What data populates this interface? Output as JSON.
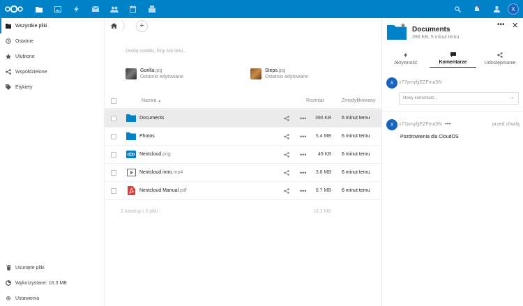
{
  "colors": {
    "brand": "#0082c9",
    "avatar": "#1565c0",
    "selected_row": "#ebebeb"
  },
  "header": {
    "avatar_initial": "X",
    "apps": [
      {
        "icon": "files-icon"
      },
      {
        "icon": "photos-icon"
      },
      {
        "icon": "activity-icon"
      },
      {
        "icon": "mail-icon"
      },
      {
        "icon": "contacts-icon"
      },
      {
        "icon": "calendar-icon"
      },
      {
        "icon": "deck-icon"
      }
    ],
    "right_icons": [
      "search-icon",
      "notifications-icon",
      "contacts-menu-icon"
    ]
  },
  "sidebar": {
    "items": [
      {
        "label": "Wszystkie pliki",
        "icon": "folder-icon"
      },
      {
        "label": "Ostatnie",
        "icon": "clock-icon"
      },
      {
        "label": "Ulubione",
        "icon": "star-icon"
      },
      {
        "label": "Współdzielone",
        "icon": "share-icon"
      },
      {
        "label": "Etykiety",
        "icon": "tag-icon"
      }
    ],
    "bottom": [
      {
        "label": "Usunięte pliki",
        "icon": "trash-icon"
      },
      {
        "label": "Wykorzystane: 16.3 MB",
        "icon": "quota-icon"
      },
      {
        "label": "Ustawienia",
        "icon": "gear-icon"
      }
    ]
  },
  "main": {
    "notes_placeholder": "Dodaj notatki, listy lub linki...",
    "recent": [
      {
        "name": "Gorilla",
        "ext": ".jpg",
        "sub": "Ostatnio edytowane"
      },
      {
        "name": "Steps",
        "ext": ".jpg",
        "sub": "Ostatnio edytowane"
      }
    ],
    "columns": {
      "name": "Nazwa",
      "sort": "▲",
      "size": "Rozmiar",
      "modified": "Zmodyfikowany"
    },
    "files": [
      {
        "name": "Documents",
        "ext": "",
        "type": "folder",
        "size": "396 KB",
        "modified": "6 minut temu"
      },
      {
        "name": "Photos",
        "ext": "",
        "type": "folder",
        "size": "5.4 MB",
        "modified": "6 minut temu"
      },
      {
        "name": "Nextcloud",
        "ext": ".png",
        "type": "image",
        "size": "49 KB",
        "modified": "6 minut temu"
      },
      {
        "name": "Nextcloud intro",
        "ext": ".mp4",
        "type": "video",
        "size": "3.8 MB",
        "modified": "6 minut temu"
      },
      {
        "name": "Nextcloud Manual",
        "ext": ".pdf",
        "type": "pdf",
        "size": "6.7 MB",
        "modified": "6 minut temu"
      }
    ],
    "summary": {
      "counts": "2 katalogi i 3 pliki",
      "total": "16.3 MB"
    }
  },
  "details": {
    "title": "Documents",
    "subtitle": "396 KB, 5 minut temu",
    "tabs": [
      {
        "label": "Aktywność",
        "icon": "activity-icon"
      },
      {
        "label": "Komentarze",
        "icon": "comment-icon"
      },
      {
        "label": "Udostępnianie",
        "icon": "share-icon"
      }
    ],
    "composer": {
      "user": "x77pmyfjjEZFma5N",
      "initial": "X",
      "placeholder": "Nowy komentarz...",
      "send": "→"
    },
    "comment": {
      "user": "x77pmyfjjEZFma5N",
      "initial": "X",
      "time": "przed chwilą",
      "text": "Pozdrowienia dla CloudOS",
      "more": "•••"
    }
  }
}
